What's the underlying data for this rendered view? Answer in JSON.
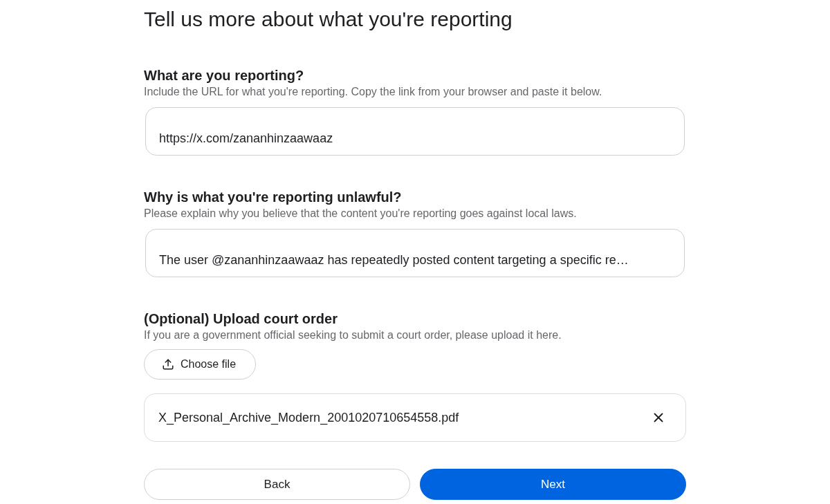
{
  "page": {
    "title": "Tell us more about what you're reporting"
  },
  "sections": [
    {
      "kind": "text_field",
      "heading": "What are you reporting?",
      "hint": "Include the URL for what you're reporting. Copy the link from your browser and paste it below.",
      "value": "https://x.com/zananhinzaawaaz"
    },
    {
      "kind": "text_field",
      "heading": "Why is what you're reporting unlawful?",
      "hint": "Please explain why you believe that the content you're reporting goes against local laws.",
      "value": "The user @zananhinzaawaaz has repeatedly posted content targeting a specific re…"
    },
    {
      "kind": "upload",
      "heading": "(Optional) Upload court order",
      "hint": "If you are a government official seeking to submit a court order, please upload it here.",
      "button": "Choose file",
      "file": {
        "name": "X_Personal_Archive_Modern_2001020710654558.pdf"
      }
    }
  ],
  "buttons": [
    {
      "kind": "secondary",
      "label": "Back"
    },
    {
      "kind": "primary",
      "label": "Next"
    }
  ]
}
